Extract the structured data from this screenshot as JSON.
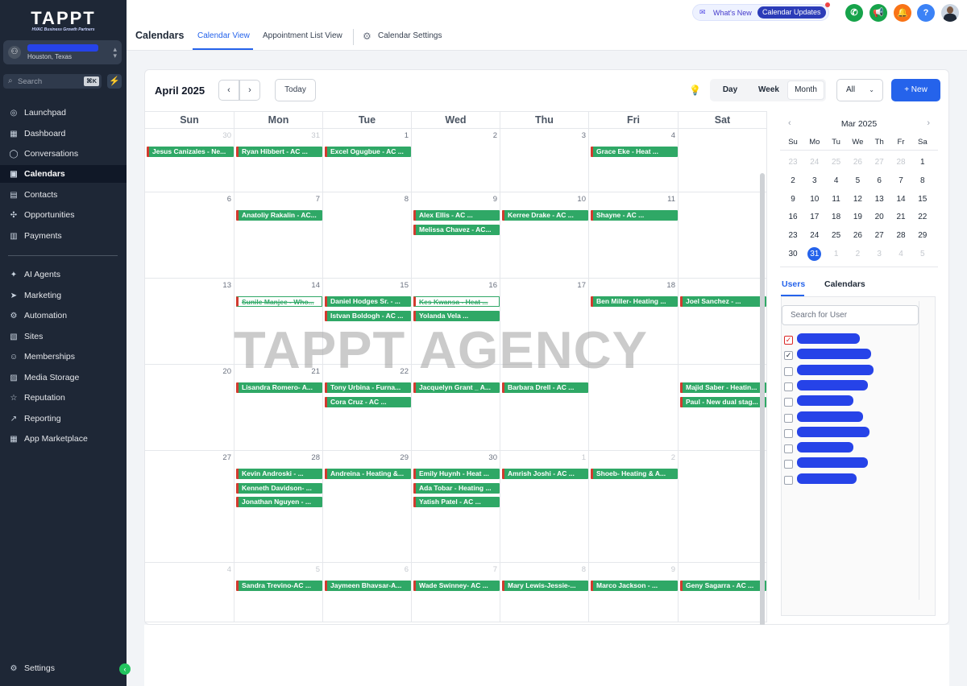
{
  "app": {
    "brand": "TAPPT",
    "tagline": "HVAC Business Growth Partners"
  },
  "location": {
    "name": "",
    "city": "Houston, Texas"
  },
  "search": {
    "placeholder": "Search",
    "shortcut": "⌘K"
  },
  "nav": [
    {
      "label": "Launchpad",
      "icon": "rocket-icon",
      "glyph": "◎"
    },
    {
      "label": "Dashboard",
      "icon": "dashboard-icon",
      "glyph": "▦"
    },
    {
      "label": "Conversations",
      "icon": "chat-icon",
      "glyph": "◯"
    },
    {
      "label": "Calendars",
      "icon": "calendar-icon",
      "glyph": "▣",
      "active": true
    },
    {
      "label": "Contacts",
      "icon": "contacts-icon",
      "glyph": "▤"
    },
    {
      "label": "Opportunities",
      "icon": "opportunities-icon",
      "glyph": "✣"
    },
    {
      "label": "Payments",
      "icon": "payments-icon",
      "glyph": "▥"
    },
    {
      "label": "AI Agents",
      "icon": "ai-agents-icon",
      "glyph": "✦"
    },
    {
      "label": "Marketing",
      "icon": "marketing-icon",
      "glyph": "➤"
    },
    {
      "label": "Automation",
      "icon": "automation-icon",
      "glyph": "⚙"
    },
    {
      "label": "Sites",
      "icon": "sites-icon",
      "glyph": "▧"
    },
    {
      "label": "Memberships",
      "icon": "memberships-icon",
      "glyph": "☺"
    },
    {
      "label": "Media Storage",
      "icon": "media-storage-icon",
      "glyph": "▨"
    },
    {
      "label": "Reputation",
      "icon": "reputation-icon",
      "glyph": "☆"
    },
    {
      "label": "Reporting",
      "icon": "reporting-icon",
      "glyph": "↗"
    },
    {
      "label": "App Marketplace",
      "icon": "marketplace-icon",
      "glyph": "▦"
    }
  ],
  "settings": {
    "label": "Settings"
  },
  "header": {
    "title": "Calendars",
    "tabs": [
      "Calendar View",
      "Appointment List View",
      "Calendar Settings"
    ],
    "whats_new": "What's New",
    "updates": "Calendar Updates"
  },
  "calendar": {
    "month": "April 2025",
    "today": "Today",
    "views": [
      "Day",
      "Week",
      "Month"
    ],
    "active_view": "Month",
    "filter": "All",
    "new": "+ New",
    "weekdays": [
      "Sun",
      "Mon",
      "Tue",
      "Wed",
      "Thu",
      "Fri",
      "Sat"
    ],
    "weeks": [
      {
        "days": [
          "30",
          "31",
          "1",
          "2",
          "3",
          "4",
          ""
        ],
        "other": [
          true,
          true,
          false,
          false,
          false,
          false,
          false
        ],
        "events": [
          [
            0,
            0,
            "Jesus Canizales - Ne..."
          ],
          [
            1,
            0,
            "Ryan Hibbert - AC ..."
          ],
          [
            2,
            0,
            "Excel Ogugbue - AC ..."
          ],
          [
            5,
            0,
            "Grace Eke - Heat ..."
          ]
        ]
      },
      {
        "days": [
          "6",
          "7",
          "8",
          "9",
          "10",
          "11",
          ""
        ],
        "other": [
          false,
          false,
          false,
          false,
          false,
          false,
          false
        ],
        "events": [
          [
            1,
            0,
            "Anatoliy Rakalin - AC..."
          ],
          [
            3,
            0,
            "Alex Ellis - AC ..."
          ],
          [
            3,
            1,
            "Melissa Chavez - AC..."
          ],
          [
            4,
            0,
            "Kerree Drake - AC ..."
          ],
          [
            5,
            0,
            "Shayne - AC ..."
          ]
        ]
      },
      {
        "days": [
          "13",
          "14",
          "15",
          "16",
          "17",
          "18",
          ""
        ],
        "other": [
          false,
          false,
          false,
          false,
          false,
          false,
          false
        ],
        "events": [
          [
            1,
            0,
            "Sunile Manjee - Who...",
            true
          ],
          [
            2,
            0,
            "Daniel Hodges Sr. - ..."
          ],
          [
            2,
            1,
            "Istvan Boldogh - AC ..."
          ],
          [
            3,
            0,
            "Kes Kwansa - Heat ...",
            true
          ],
          [
            3,
            1,
            "Yolanda Vela ..."
          ],
          [
            5,
            0,
            "Ben Miller- Heating ..."
          ],
          [
            6,
            0,
            "Joel Sanchez - ..."
          ]
        ]
      },
      {
        "days": [
          "20",
          "21",
          "22",
          "",
          "",
          "",
          ""
        ],
        "other": [
          false,
          false,
          false,
          false,
          false,
          false,
          false
        ],
        "events": [
          [
            1,
            0,
            "Lisandra Romero- A..."
          ],
          [
            2,
            0,
            "Tony Urbina - Furna..."
          ],
          [
            2,
            1,
            "Cora Cruz - AC ..."
          ],
          [
            3,
            0,
            "Jacquelyn Grant _ A..."
          ],
          [
            4,
            0,
            "Barbara Drell - AC ..."
          ],
          [
            6,
            0,
            "Majid Saber - Heatin..."
          ],
          [
            6,
            1,
            "Paul - New dual stag..."
          ]
        ]
      },
      {
        "days": [
          "27",
          "28",
          "29",
          "30",
          "1",
          "2",
          ""
        ],
        "other": [
          false,
          false,
          false,
          false,
          true,
          true,
          false
        ],
        "events": [
          [
            1,
            0,
            "Kevin Androski - ..."
          ],
          [
            1,
            1,
            "Kenneth Davidson- ..."
          ],
          [
            1,
            2,
            "Jonathan Nguyen - ..."
          ],
          [
            2,
            0,
            "Andreina - Heating &..."
          ],
          [
            3,
            0,
            "Emily Huynh - Heat ..."
          ],
          [
            3,
            1,
            "Ada Tobar - Heating ..."
          ],
          [
            3,
            2,
            "Yatish Patel - AC ..."
          ],
          [
            4,
            0,
            "Amrish Joshi - AC ..."
          ],
          [
            5,
            0,
            "Shoeb- Heating & A..."
          ]
        ]
      },
      {
        "days": [
          "4",
          "5",
          "6",
          "7",
          "8",
          "9",
          ""
        ],
        "other": [
          true,
          true,
          true,
          true,
          true,
          true,
          true
        ],
        "events": [
          [
            1,
            0,
            "Sandra Trevino-AC ..."
          ],
          [
            2,
            0,
            "Jaymeen Bhavsar-A..."
          ],
          [
            3,
            0,
            "Wade Swinney- AC ..."
          ],
          [
            4,
            0,
            "Mary Lewis-Jessie-..."
          ],
          [
            5,
            0,
            "Marco Jackson - ..."
          ],
          [
            6,
            0,
            "Geny Sagarra - AC ..."
          ]
        ]
      }
    ]
  },
  "mini": {
    "title": "Mar 2025",
    "weekdays": [
      "Su",
      "Mo",
      "Tu",
      "We",
      "Th",
      "Fr",
      "Sa"
    ],
    "rows": [
      [
        "23",
        "24",
        "25",
        "26",
        "27",
        "28",
        "1"
      ],
      [
        "2",
        "3",
        "4",
        "5",
        "6",
        "7",
        "8"
      ],
      [
        "9",
        "10",
        "11",
        "12",
        "13",
        "14",
        "15"
      ],
      [
        "16",
        "17",
        "18",
        "19",
        "20",
        "21",
        "22"
      ],
      [
        "23",
        "24",
        "25",
        "26",
        "27",
        "28",
        "29"
      ],
      [
        "30",
        "31",
        "1",
        "2",
        "3",
        "4",
        "5"
      ]
    ],
    "selected": "31"
  },
  "users": {
    "tabs": [
      "Users",
      "Calendars"
    ],
    "search_placeholder": "Search for User",
    "rows": [
      {
        "check": "red"
      },
      {
        "check": "checked"
      },
      {},
      {},
      {},
      {},
      {},
      {},
      {},
      {}
    ]
  },
  "watermark": "TAPPT AGENCY"
}
